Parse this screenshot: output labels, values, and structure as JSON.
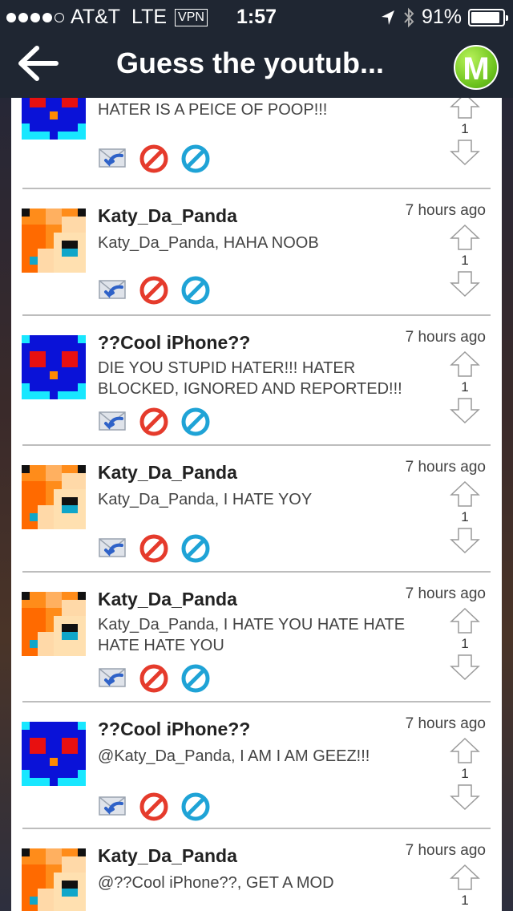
{
  "status_bar": {
    "carrier": "AT&T",
    "network": "LTE",
    "vpn": "VPN",
    "time": "1:57",
    "battery": "91%",
    "battery_level": 0.91
  },
  "header": {
    "title": "Guess the youtub...",
    "badge_letter": "M"
  },
  "comments": [
    {
      "avatar": "blue-creature-avatar",
      "username": "",
      "time": "",
      "message": "HATER IS A PEICE OF POOP!!!",
      "votes": "1"
    },
    {
      "avatar": "panda-avatar",
      "username": "Katy_Da_Panda",
      "time": "7 hours ago",
      "message": "Katy_Da_Panda, HAHA NOOB",
      "votes": "1"
    },
    {
      "avatar": "blue-creature-avatar",
      "username": "??Cool iPhone??",
      "time": "7 hours ago",
      "message": "DIE YOU STUPID HATER!!! HATER BLOCKED, IGNORED AND REPORTED!!!",
      "votes": "1"
    },
    {
      "avatar": "panda-avatar",
      "username": "Katy_Da_Panda",
      "time": "7 hours ago",
      "message": "Katy_Da_Panda, I HATE YOY",
      "votes": "1"
    },
    {
      "avatar": "panda-avatar",
      "username": "Katy_Da_Panda",
      "time": "7 hours ago",
      "message": "Katy_Da_Panda, I HATE YOU HATE HATE HATE HATE YOU",
      "votes": "1"
    },
    {
      "avatar": "blue-creature-avatar",
      "username": "??Cool iPhone??",
      "time": "7 hours ago",
      "message": "@Katy_Da_Panda, I AM I AM GEEZ!!!",
      "votes": "1"
    },
    {
      "avatar": "panda-avatar",
      "username": "Katy_Da_Panda",
      "time": "7 hours ago",
      "message": "@??Cool iPhone??, GET A MOD",
      "votes": "1"
    }
  ],
  "icons": {
    "reply": "reply-mail-icon",
    "report": "report-icon",
    "block": "block-icon",
    "upvote": "upvote-arrow-icon",
    "downvote": "downvote-arrow-icon"
  },
  "colors": {
    "bar_bg": "#1f2632",
    "report_red": "#e53b2c",
    "block_blue": "#1fa3d6",
    "badge_green": "#6cc31d"
  }
}
